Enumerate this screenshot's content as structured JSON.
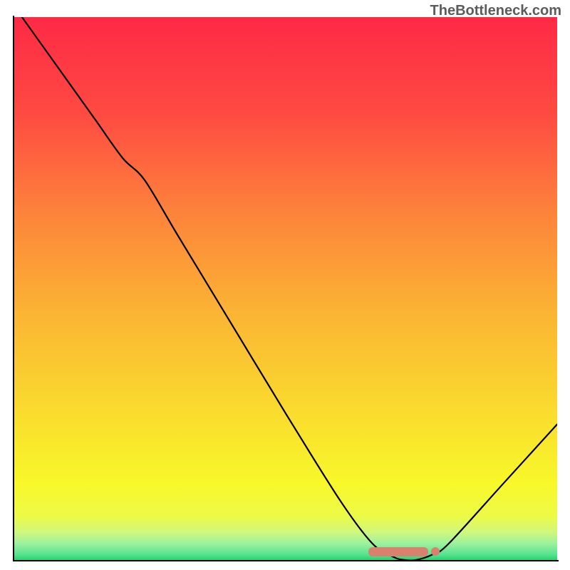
{
  "watermark": "TheBottleneck.com",
  "chart_data": {
    "type": "line",
    "title": "",
    "xlabel": "",
    "ylabel": "",
    "xlim": [
      0,
      100
    ],
    "ylim": [
      0,
      100
    ],
    "grid": false,
    "series": [
      {
        "name": "curve",
        "x": [
          0,
          5,
          10,
          15,
          20,
          24,
          30,
          40,
          50,
          60,
          66,
          70,
          72,
          74,
          77,
          80,
          90,
          100
        ],
        "y": [
          102,
          95,
          88,
          81,
          74,
          70,
          60,
          43.5,
          27,
          11,
          3,
          0.5,
          0,
          0,
          1,
          3,
          14,
          25
        ]
      }
    ],
    "markers": {
      "x_start": 66,
      "x_end": 75.5,
      "y": 1.6,
      "dot_x": 77.5,
      "dot_y": 1.6
    },
    "gradient_stops": [
      {
        "pos": 0.0,
        "color": "#fe2946"
      },
      {
        "pos": 0.18,
        "color": "#fe4b42"
      },
      {
        "pos": 0.36,
        "color": "#fd833b"
      },
      {
        "pos": 0.54,
        "color": "#fbb334"
      },
      {
        "pos": 0.72,
        "color": "#fada2e"
      },
      {
        "pos": 0.86,
        "color": "#f8f82a"
      },
      {
        "pos": 0.92,
        "color": "#ecfa47"
      },
      {
        "pos": 0.95,
        "color": "#cdf780"
      },
      {
        "pos": 0.97,
        "color": "#9bf19e"
      },
      {
        "pos": 0.99,
        "color": "#57e38f"
      },
      {
        "pos": 1.0,
        "color": "#24d36d"
      }
    ]
  }
}
